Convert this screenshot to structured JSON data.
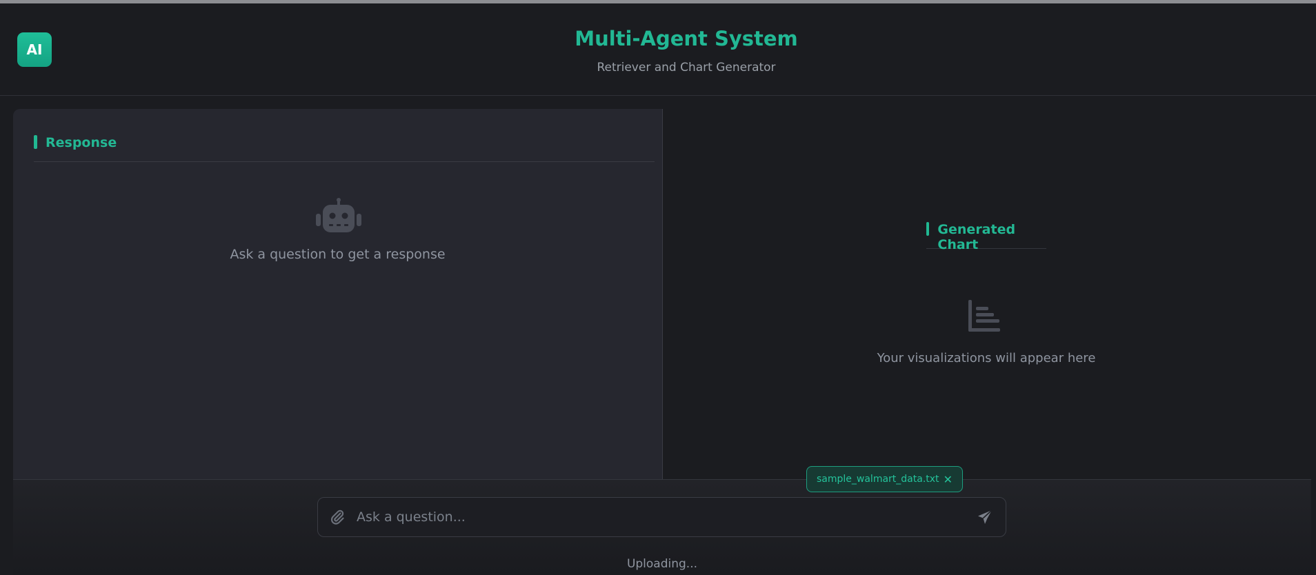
{
  "header": {
    "logo_text": "AI",
    "title": "Multi-Agent System",
    "subtitle": "Retriever and Chart Generator"
  },
  "response_panel": {
    "title": "Response",
    "icon": "robot-icon",
    "empty_text": "Ask a question to get a response"
  },
  "chart_panel": {
    "title": "Generated Chart",
    "icon": "chart-bar-icon",
    "empty_text": "Your visualizations will appear here"
  },
  "attachment": {
    "filename": "sample_walmart_data.txt",
    "close_symbol": "✕"
  },
  "composer": {
    "placeholder": "Ask a question...",
    "attach_icon": "paperclip-icon",
    "send_icon": "send-icon"
  },
  "status_text": "Uploading...",
  "colors": {
    "accent": "#22b894",
    "background": "#1b1c20",
    "panel": "#26272f"
  }
}
